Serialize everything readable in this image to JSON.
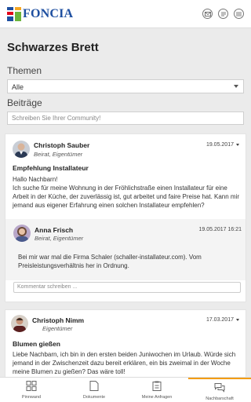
{
  "header": {
    "logo_text": "FONCIA",
    "icons": [
      "mail-icon",
      "chat-icon",
      "menu-icon"
    ]
  },
  "page": {
    "title": "Schwarzes Brett",
    "themen_label": "Themen",
    "themen_value": "Alle",
    "beitraege_label": "Beiträge",
    "search_placeholder": "Schreiben Sie Ihrer Community!"
  },
  "posts": [
    {
      "author": "Christoph Sauber",
      "role": "Beirat, Eigentümer",
      "date": "19.05.2017",
      "title": "Empfehlung Installateur",
      "body": "Hallo Nachbarn!\nIch suche für meine Wohnung in der Fröhlichstraße einen Installateur für eine Arbeit in der Küche, der zuverlässig ist, gut arbeitet und faire Preise hat. Kann mir jemand aus eigener Erfahrung einen solchen Installateur empfehlen?",
      "reply": {
        "author": "Anna Frisch",
        "role": "Beirat, Eigentümer",
        "date": "19.05.2017 16:21",
        "body": "Bei mir war mal die Firma Schaler (schaller-installateur.com). Vom Preisleistungsverhältnis her in Ordnung."
      },
      "comment_placeholder": "Kommentar schreiben ..."
    },
    {
      "author": "Christoph Nimm",
      "role": "Eigentümer",
      "date": "17.03.2017",
      "title": "Blumen gießen",
      "body": "Liebe Nachbarn, ich bin in den ersten beiden Juniwochen im Urlaub. Würde sich jemand in der Zwischenzeit dazu bereit erklären, ein bis zweimal in der Woche meine Blumen zu gießen? Das wäre toll!"
    }
  ],
  "tabs": [
    {
      "label": "Pinnwand",
      "icon": "grid-icon"
    },
    {
      "label": "Dokumente",
      "icon": "document-icon"
    },
    {
      "label": "Meine Anfragen",
      "icon": "clipboard-icon"
    },
    {
      "label": "Nachbarschaft",
      "icon": "chat-bubbles-icon",
      "active": true
    }
  ],
  "colors": {
    "brand_blue": "#1e4fa0",
    "active_tab": "#f39c12"
  }
}
